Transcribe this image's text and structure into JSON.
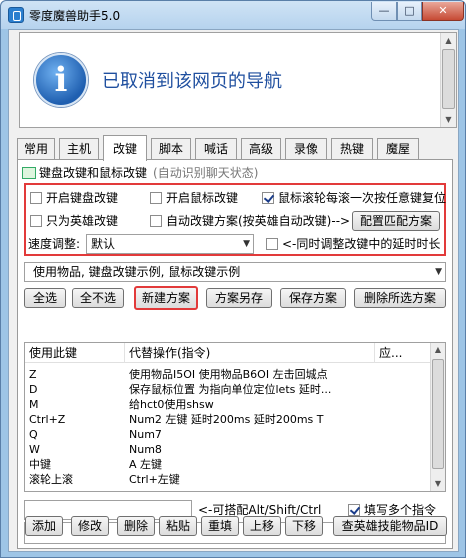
{
  "window": {
    "title": "零度魔兽助手5.0",
    "minimize_label": "—",
    "maximize_label": "□",
    "close_label": "✕"
  },
  "banner": {
    "message": "已取消到该网页的导航",
    "icon": "info-icon",
    "icon_glyph": "i"
  },
  "tabs": [
    {
      "label": "常用"
    },
    {
      "label": "主机"
    },
    {
      "label": "改键",
      "active": true
    },
    {
      "label": "脚本"
    },
    {
      "label": "喊话"
    },
    {
      "label": "高级"
    },
    {
      "label": "录像"
    },
    {
      "label": "热键"
    },
    {
      "label": "魔屋"
    }
  ],
  "section": {
    "title": "键盘改键和鼠标改键",
    "hint": "(自动识别聊天状态)"
  },
  "options": {
    "enable_keyboard": {
      "label": "开启键盘改键",
      "checked": false
    },
    "enable_mouse": {
      "label": "开启鼠标改键",
      "checked": false
    },
    "wheel_reset": {
      "label": "鼠标滚轮每滚一次按任意键复位",
      "checked": true
    },
    "hero_only": {
      "label": "只为英雄改键",
      "checked": false
    },
    "auto_scheme": {
      "label": "自动改键方案(按英雄自动改键)-->",
      "checked": false
    },
    "config_match_button": "配置匹配方案",
    "speed_label": "速度调整:",
    "speed_value": "默认",
    "sync_delay": {
      "label": "<-同时调整改键中的延时时长",
      "checked": false
    }
  },
  "scheme": {
    "selected": "使用物品, 键盘改键示例, 鼠标改键示例"
  },
  "scheme_buttons": {
    "select_all": "全选",
    "select_none": "全不选",
    "new_scheme": "新建方案",
    "save_as": "方案另存",
    "save": "保存方案",
    "delete_selected": "删除所选方案"
  },
  "list": {
    "columns": [
      "使用此键",
      "代替操作(指令)",
      "应..."
    ],
    "rows": [
      {
        "key": "Z",
        "action": "使用物品I5OI 使用物品B6OI 左击回城点"
      },
      {
        "key": "D",
        "action": "保存鼠标位置 为指向单位定位lets 延时..."
      },
      {
        "key": "M",
        "action": "给hct0使用shsw"
      },
      {
        "key": "Ctrl+Z",
        "action": "Num2 左键 延时200ms 延时200ms T"
      },
      {
        "key": "Q",
        "action": "Num7"
      },
      {
        "key": "W",
        "action": "Num8"
      },
      {
        "key": "中键",
        "action": "A 左键"
      },
      {
        "key": "滚轮上滚",
        "action": "Ctrl+左键"
      }
    ]
  },
  "bottom": {
    "modifier_hint": "<-可搭配Alt/Shift/Ctrl",
    "multi_command": {
      "label": "填写多个指令",
      "checked": true
    },
    "buttons": {
      "add": "添加",
      "edit": "修改",
      "delete": "删除",
      "paste": "粘贴",
      "reset": "重填",
      "up": "上移",
      "down": "下移",
      "lookup": "查英雄技能物品ID"
    }
  }
}
